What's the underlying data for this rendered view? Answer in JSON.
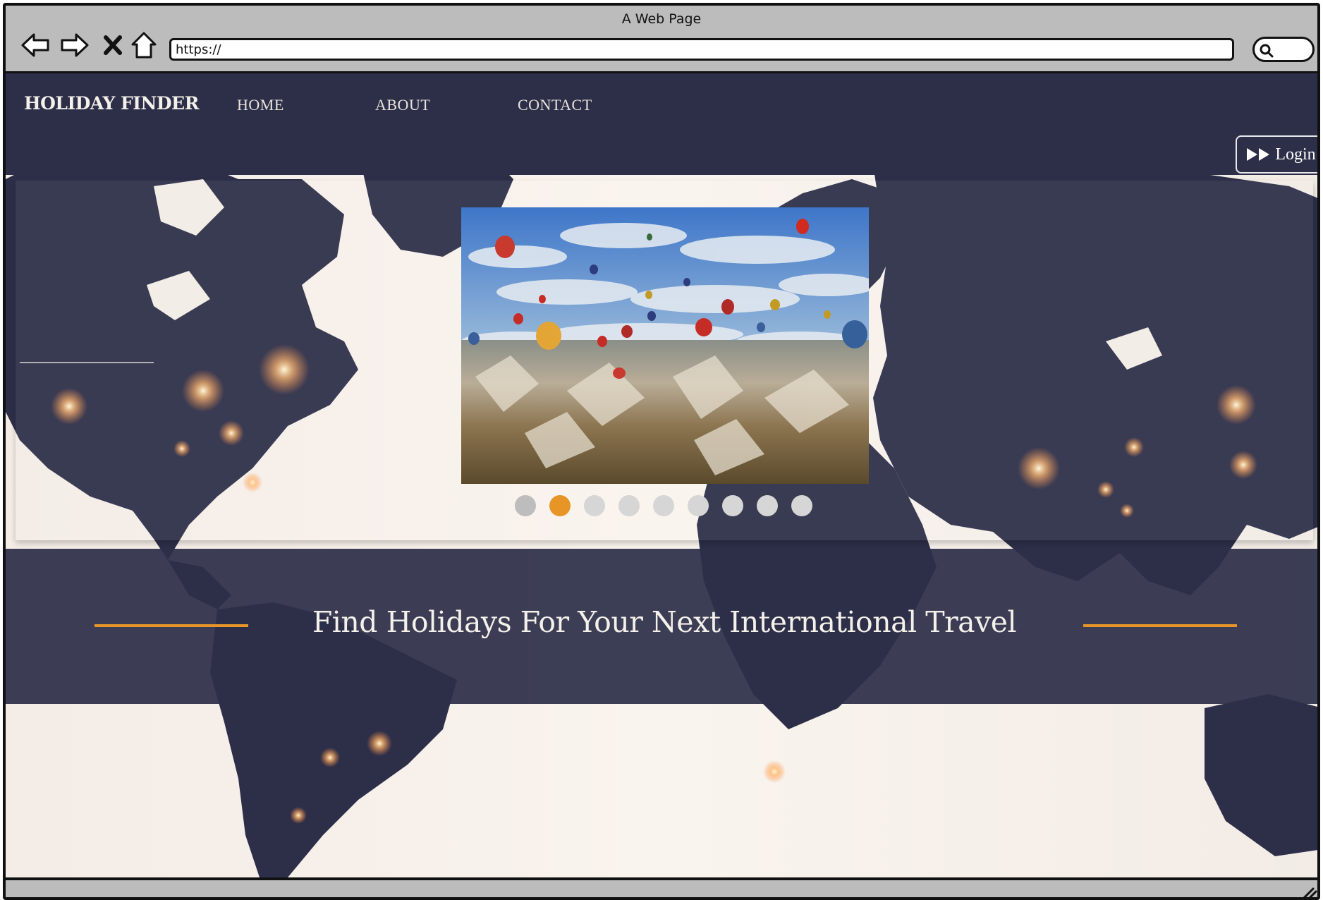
{
  "browser": {
    "title": "A Web Page",
    "url": "https://",
    "icons": {
      "back": "back-arrow-icon",
      "forward": "forward-arrow-icon",
      "stop": "close-icon",
      "home": "home-icon",
      "search": "search-icon",
      "resize": "resize-grip-icon"
    }
  },
  "site": {
    "brand": "HOLIDAY FINDER",
    "nav": [
      {
        "label": "HOME"
      },
      {
        "label": "ABOUT"
      },
      {
        "label": "CONTACT"
      }
    ],
    "login_label": "Login",
    "login_icon": "fast-forward-icon"
  },
  "hero": {
    "slide_image": "hot-air-balloons-landscape",
    "slide_count": 9,
    "active_slide": 2
  },
  "tagline": "Find Holidays For Your Next International Travel",
  "colors": {
    "navy": "#2d2f49",
    "accent": "#e69526",
    "map_background": "#f3ece6"
  }
}
